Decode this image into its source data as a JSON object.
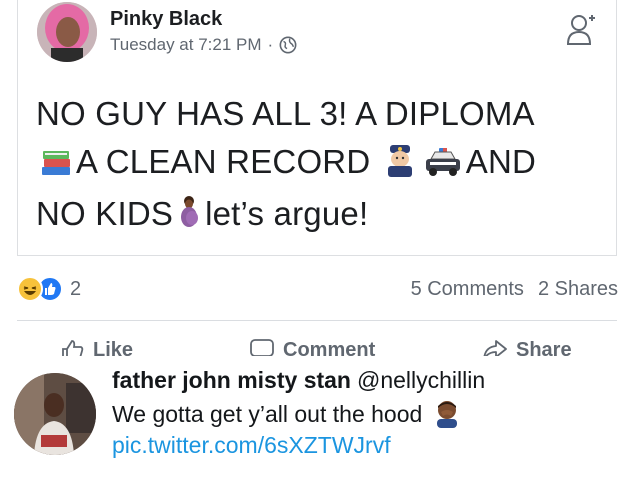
{
  "facebook_post": {
    "author": "Pinky Black",
    "timestamp": "Tuesday at 7:21 PM",
    "separator": "·",
    "privacy_icon": "globe-icon",
    "line1": "NO GUY HAS ALL 3! A DIPLOMA",
    "line2_text": "A CLEAN RECORD",
    "line2_end": "AND",
    "line3_text": "NO KIDS",
    "line3_end": "let’s argue!",
    "reactions_count": "2",
    "comments": "5 Comments",
    "shares": "2 Shares",
    "actions": {
      "like": "Like",
      "comment": "Comment",
      "share": "Share"
    },
    "colors": {
      "like_blue": "#2078f4",
      "haha_yellow": "#f7c23b",
      "meta_gray": "#606770"
    }
  },
  "tweet": {
    "name": "father john misty stan",
    "handle": "@nellychillin",
    "text": "We gotta get y’all out the hood",
    "link": "pic.twitter.com/6sXZTWJrvf",
    "colors": {
      "link": "#1b95e0"
    }
  }
}
